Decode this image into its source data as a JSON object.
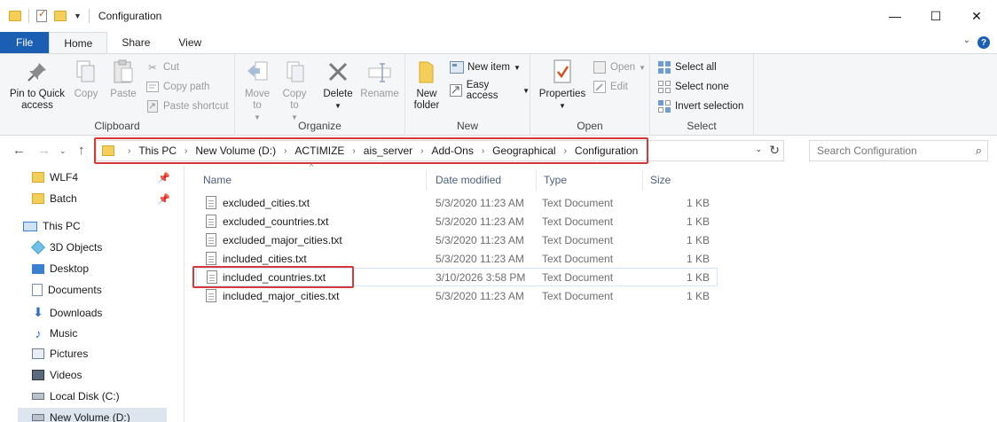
{
  "window": {
    "title": "Configuration",
    "controls": {
      "minimize": "—",
      "maximize": "☐",
      "close": "✕"
    }
  },
  "ribbon_tabs": [
    "File",
    "Home",
    "Share",
    "View"
  ],
  "ribbon": {
    "clipboard": {
      "label": "Clipboard",
      "pin": "Pin to Quick access",
      "copy": "Copy",
      "paste": "Paste",
      "cut": "Cut",
      "copy_path": "Copy path",
      "paste_shortcut": "Paste shortcut"
    },
    "organize": {
      "label": "Organize",
      "move_to": "Move to",
      "copy_to": "Copy to",
      "delete": "Delete",
      "rename": "Rename"
    },
    "new": {
      "label": "New",
      "new_folder": "New folder",
      "new_item": "New item",
      "easy_access": "Easy access"
    },
    "open": {
      "label": "Open",
      "properties": "Properties",
      "open": "Open",
      "edit": "Edit"
    },
    "select": {
      "label": "Select",
      "select_all": "Select all",
      "select_none": "Select none",
      "invert": "Invert selection"
    }
  },
  "address": {
    "crumbs": [
      "This PC",
      "New Volume (D:)",
      "ACTIMIZE",
      "ais_server",
      "Add-Ons",
      "Geographical",
      "Configuration"
    ],
    "search_placeholder": "Search Configuration"
  },
  "nav_pane": {
    "quick_access": [
      "WLF4",
      "Batch"
    ],
    "this_pc_label": "This PC",
    "this_pc_items": [
      "3D Objects",
      "Desktop",
      "Documents",
      "Downloads",
      "Music",
      "Pictures",
      "Videos",
      "Local Disk (C:)",
      "New Volume (D:)"
    ]
  },
  "columns": {
    "name": "Name",
    "date": "Date modified",
    "type": "Type",
    "size": "Size"
  },
  "files": [
    {
      "name": "excluded_cities.txt",
      "date": "5/3/2020 11:23 AM",
      "type": "Text Document",
      "size": "1 KB"
    },
    {
      "name": "excluded_countries.txt",
      "date": "5/3/2020 11:23 AM",
      "type": "Text Document",
      "size": "1 KB"
    },
    {
      "name": "excluded_major_cities.txt",
      "date": "5/3/2020 11:23 AM",
      "type": "Text Document",
      "size": "1 KB"
    },
    {
      "name": "included_cities.txt",
      "date": "5/3/2020 11:23 AM",
      "type": "Text Document",
      "size": "1 KB"
    },
    {
      "name": "included_countries.txt",
      "date": "3/10/2026 3:58 PM",
      "type": "Text Document",
      "size": "1 KB"
    },
    {
      "name": "included_major_cities.txt",
      "date": "5/3/2020 11:23 AM",
      "type": "Text Document",
      "size": "1 KB"
    }
  ],
  "colors": {
    "accent": "#1a5fb4",
    "highlight": "#d9383a",
    "folder": "#f3cf5a"
  }
}
